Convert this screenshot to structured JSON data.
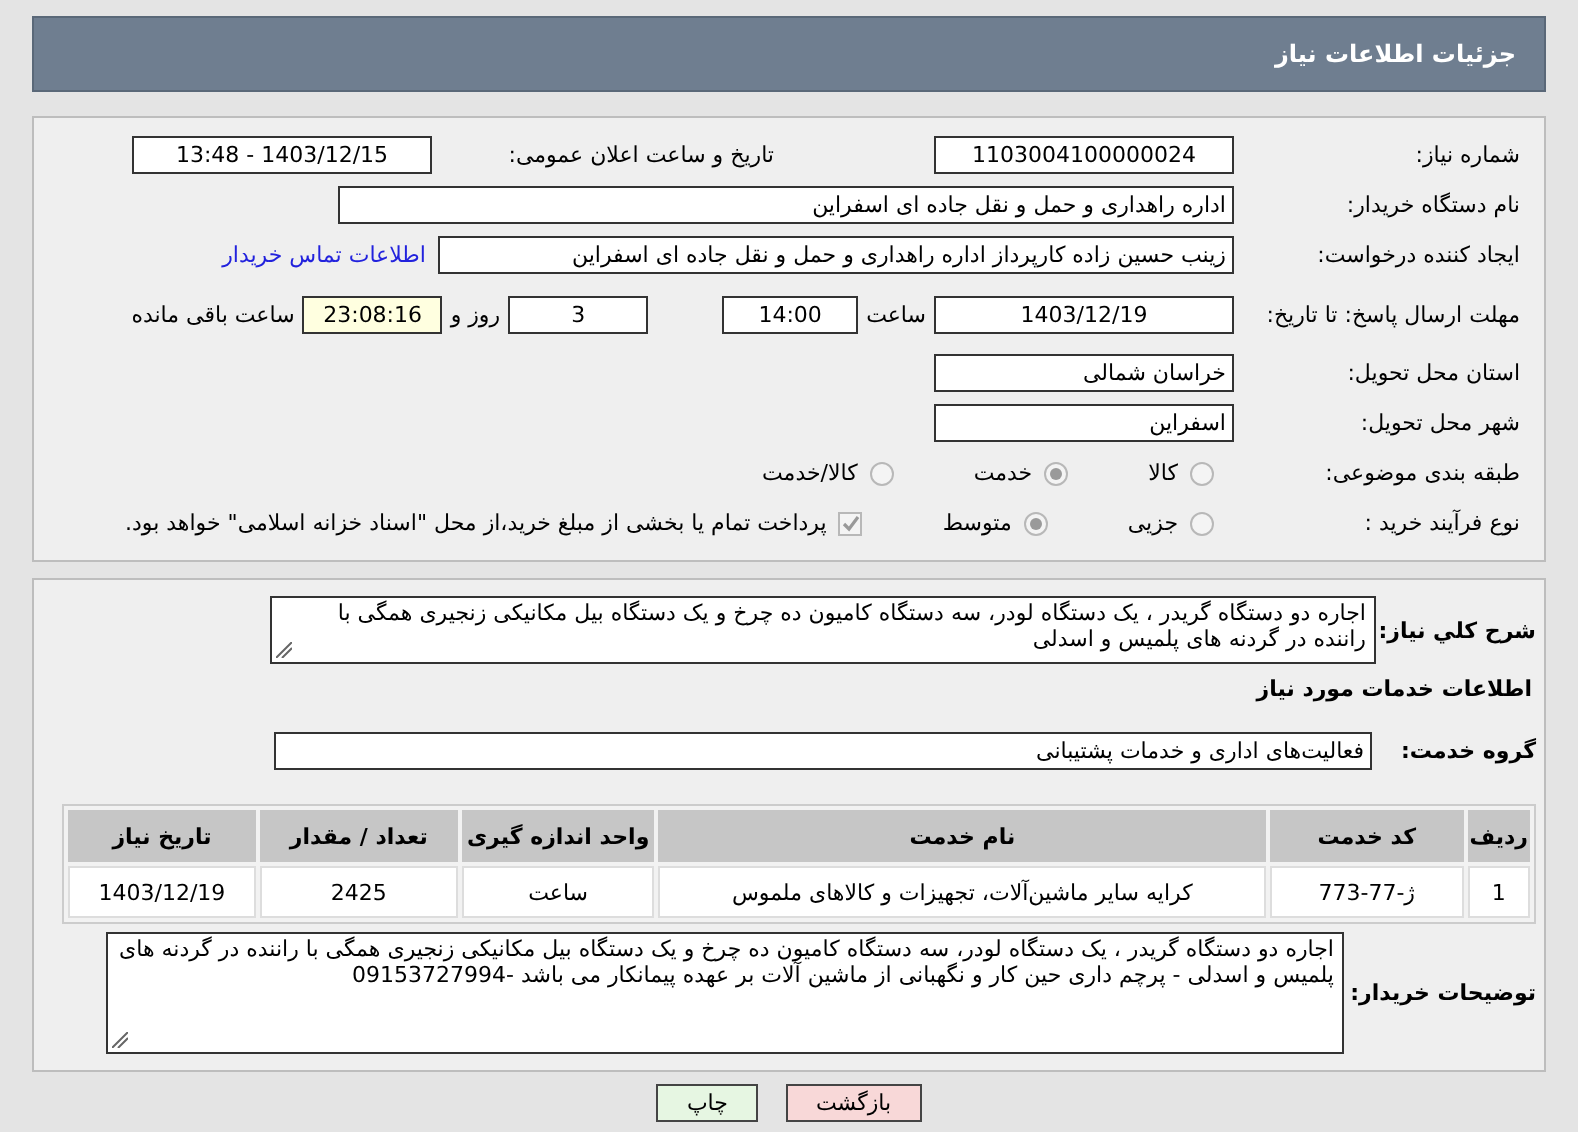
{
  "header": {
    "title": "جزئیات اطلاعات نیاز"
  },
  "details": {
    "need_number": {
      "label": "شماره نیاز:",
      "value": "1103004100000024"
    },
    "announce": {
      "label": "تاریخ و ساعت اعلان عمومی:",
      "value": "1403/12/15 - 13:48"
    },
    "buyer_org": {
      "label": "نام دستگاه خریدار:",
      "value": "اداره راهداری و حمل و نقل جاده ای اسفراین"
    },
    "requester": {
      "label": "ایجاد کننده درخواست:",
      "value": "زینب حسین زاده کارپرداز اداره راهداری و حمل و نقل جاده ای اسفراین",
      "link": "اطلاعات تماس خریدار"
    },
    "deadline": {
      "label": "مهلت ارسال پاسخ: تا تاریخ:",
      "date": "1403/12/19",
      "time_label": "ساعت",
      "time": "14:00",
      "days": "3",
      "days_label": "روز و",
      "remaining": "23:08:16",
      "remaining_label": "ساعت باقی مانده"
    },
    "province": {
      "label": "استان محل تحویل:",
      "value": "خراسان شمالی"
    },
    "city": {
      "label": "شهر محل تحویل:",
      "value": "اسفراین"
    },
    "category": {
      "label": "طبقه بندی موضوعی:",
      "options": [
        {
          "label": "کالا",
          "selected": false
        },
        {
          "label": "خدمت",
          "selected": true
        },
        {
          "label": "کالا/خدمت",
          "selected": false
        }
      ]
    },
    "process": {
      "label": "نوع فرآیند خرید :",
      "options": [
        {
          "label": "جزیی",
          "selected": false
        },
        {
          "label": "متوسط",
          "selected": true
        }
      ],
      "payment": {
        "label": "پرداخت تمام یا بخشی از مبلغ خرید،از محل \"اسناد خزانه اسلامی\" خواهد بود.",
        "checked": true
      }
    }
  },
  "summary": {
    "label": "شرح کلي نیاز:",
    "value": "اجاره دو دستگاه گریدر ، یک دستگاه لودر، سه دستگاه کامیون ده چرخ و یک دستگاه بیل مکانیکی زنجیری همگی با راننده در گردنه های پلمیس و اسدلی"
  },
  "services": {
    "title": "اطلاعات خدمات مورد نیاز",
    "group_label": "گروه خدمت:",
    "group_value": "فعالیت‌های اداری و خدمات پشتیبانی",
    "table": {
      "columns": [
        "ردیف",
        "کد خدمت",
        "نام خدمت",
        "واحد اندازه گیری",
        "تعداد / مقدار",
        "تاریخ نیاز"
      ],
      "rows": [
        [
          "1",
          "ژ-77-773",
          "کرایه سایر ماشین‌آلات، تجهیزات و کالاهای ملموس",
          "ساعت",
          "2425",
          "1403/12/19"
        ]
      ]
    }
  },
  "notes": {
    "label": "توضیحات خریدار:",
    "value": "اجاره دو دستگاه گریدر ، یک دستگاه لودر، سه دستگاه کامیون ده چرخ و یک دستگاه بیل مکانیکی زنجیری همگی با راننده در گردنه های پلمیس و اسدلی - پرچم داری حین کار و نگهبانی از ماشین آلات بر عهده پیمانکار می باشد -09153727994"
  },
  "buttons": [
    {
      "label": "بازگشت",
      "kind": "back"
    },
    {
      "label": "چاپ",
      "kind": "print"
    }
  ]
}
